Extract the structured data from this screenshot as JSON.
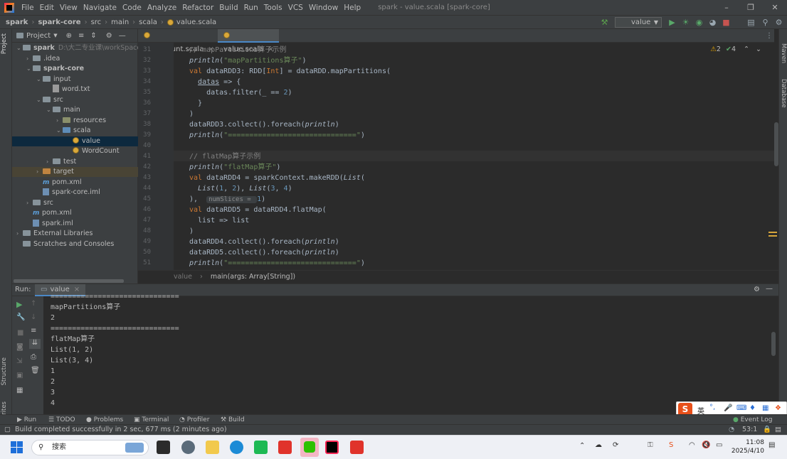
{
  "menu": [
    "File",
    "Edit",
    "View",
    "Navigate",
    "Code",
    "Analyze",
    "Refactor",
    "Build",
    "Run",
    "Tools",
    "VCS",
    "Window",
    "Help"
  ],
  "window_title": "spark - value.scala [spark-core]",
  "breadcrumbs": [
    "spark",
    "spark-core",
    "src",
    "main",
    "scala",
    "value.scala"
  ],
  "run_config": "value",
  "left_tabs": [
    "Project",
    "Structure",
    "Favorites"
  ],
  "right_tabs": [
    "Maven",
    "Database"
  ],
  "project": {
    "header": "Project",
    "tree": [
      {
        "label": "spark",
        "extra": "D:\\大二专业课\\workSpace\\",
        "arrow": "v",
        "icon": "folder-mod",
        "indent": 0
      },
      {
        "label": ".idea",
        "arrow": ">",
        "icon": "folder",
        "indent": 1
      },
      {
        "label": "spark-core",
        "arrow": "v",
        "icon": "folder-mod",
        "indent": 1
      },
      {
        "label": "input",
        "arrow": "v",
        "icon": "folder",
        "indent": 2
      },
      {
        "label": "word.txt",
        "arrow": "",
        "icon": "file",
        "indent": 3
      },
      {
        "label": "src",
        "arrow": "v",
        "icon": "folder",
        "indent": 2
      },
      {
        "label": "main",
        "arrow": "v",
        "icon": "folder",
        "indent": 3
      },
      {
        "label": "resources",
        "arrow": ">",
        "icon": "folder-res",
        "indent": 4
      },
      {
        "label": "scala",
        "arrow": "v",
        "icon": "folder-src",
        "indent": 4
      },
      {
        "label": "value",
        "arrow": "",
        "icon": "scala",
        "indent": 5
      },
      {
        "label": "WordCount",
        "arrow": "",
        "icon": "scala",
        "indent": 5
      },
      {
        "label": "test",
        "arrow": ">",
        "icon": "folder",
        "indent": 3
      },
      {
        "label": "target",
        "arrow": ">",
        "icon": "folder-tgt",
        "indent": 2
      },
      {
        "label": "pom.xml",
        "arrow": "",
        "icon": "mvn",
        "indent": 2
      },
      {
        "label": "spark-core.iml",
        "arrow": "",
        "icon": "iml",
        "indent": 2
      },
      {
        "label": "src",
        "arrow": ">",
        "icon": "folder",
        "indent": 1
      },
      {
        "label": "pom.xml",
        "arrow": "",
        "icon": "mvn",
        "indent": 1
      },
      {
        "label": "spark.iml",
        "arrow": "",
        "icon": "iml",
        "indent": 1
      },
      {
        "label": "External Libraries",
        "arrow": ">",
        "icon": "lib",
        "indent": 0
      },
      {
        "label": "Scratches and Consoles",
        "arrow": "",
        "icon": "scratch",
        "indent": 0
      }
    ]
  },
  "tabs": [
    {
      "label": "WordCount.scala"
    },
    {
      "label": "value.scala"
    }
  ],
  "inspections": {
    "warnings": "2",
    "checks": "4"
  },
  "line_numbers": [
    "31",
    "32",
    "33",
    "34",
    "35",
    "36",
    "37",
    "38",
    "39",
    "40",
    "41",
    "42",
    "43",
    "44",
    "45",
    "46",
    "47",
    "48",
    "49",
    "50",
    "51"
  ],
  "editor_crumbs": [
    "value",
    "main(args: Array[String])"
  ],
  "run": {
    "title": "Run:",
    "tab": "value",
    "output": [
      "==============================",
      "mapPartitions算子",
      "2",
      "==============================",
      "flatMap算子",
      "List(1, 2)",
      "List(3, 4)",
      "1",
      "2",
      "3",
      "4"
    ]
  },
  "tool_tabs": [
    "Run",
    "TODO",
    "Problems",
    "Terminal",
    "Profiler",
    "Build"
  ],
  "event_log": "Event Log",
  "status": {
    "message": "Build completed successfully in 2 sec, 677 ms (2 minutes ago)",
    "position": "53:1"
  },
  "ime": {
    "label": "英"
  },
  "taskbar": {
    "search_placeholder": "搜索",
    "time": "11:08",
    "date": "2025/4/10"
  }
}
